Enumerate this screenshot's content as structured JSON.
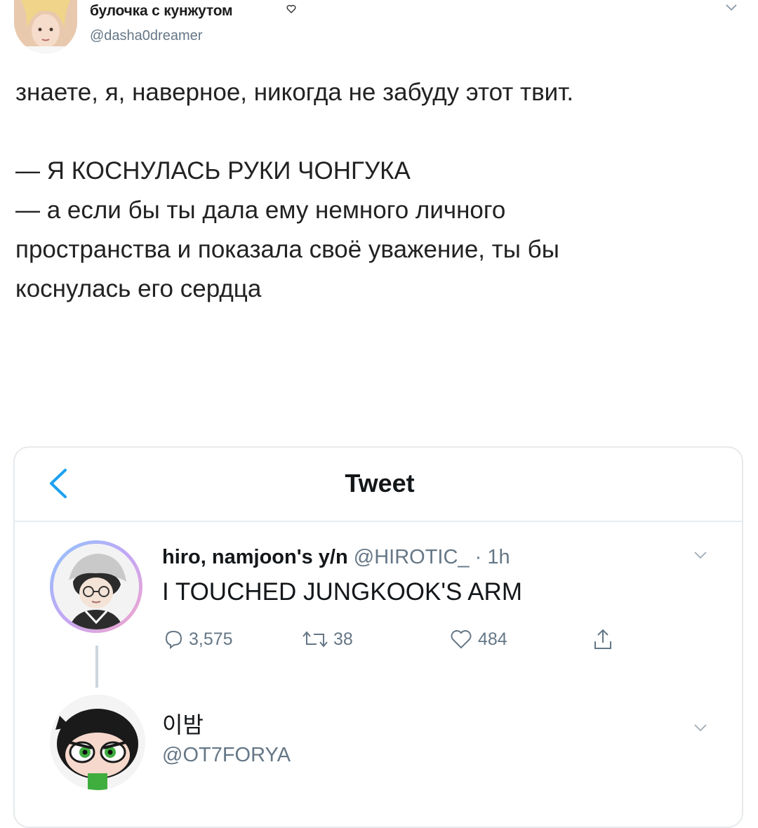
{
  "outer_tweet": {
    "display_name": "булочка с кунжутом",
    "handle": "@dasha0dreamer",
    "text": "знаете, я, наверное, никогда не забуду этот твит.\n\n— Я КОСНУЛАСЬ РУКИ ЧОНГУКА\n— а если бы ты дала ему немного личного\nпространства и показала своё уважение, ты бы\nкоснулась его сердца",
    "icons": [
      "avatar",
      "heart-outline-icon",
      "chevron-down-icon"
    ]
  },
  "embedded_screenshot": {
    "header": {
      "back_icon": "chevron-left-icon",
      "title": "Tweet"
    },
    "tweets": [
      {
        "display_name": "hiro, namjoon's y/n",
        "handle": "@HIROTIC_",
        "time": "· 1h",
        "text": "I TOUCHED JUNGKOOK'S ARM",
        "actions": {
          "replies": "3,575",
          "retweets": "38",
          "likes": "484"
        }
      },
      {
        "display_name": "이밤",
        "handle": "@OT7FORYA"
      }
    ],
    "colors": {
      "accent": "#1da1f2",
      "muted": "#657786",
      "border": "#e6ecf0"
    }
  }
}
